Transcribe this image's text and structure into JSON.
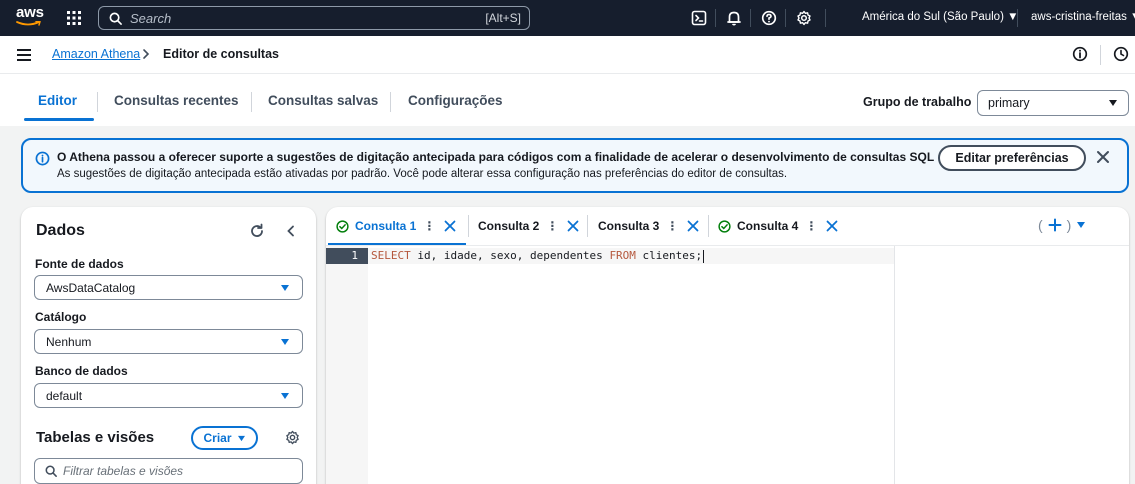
{
  "topnav": {
    "logo_text": "aws",
    "search_placeholder": "Search",
    "search_shortcut": "[Alt+S]",
    "region": "América do Sul (São Paulo) ▼",
    "account": "aws-cristina-freitas ▼"
  },
  "breadcrumb": {
    "service": "Amazon Athena",
    "current": "Editor de consultas"
  },
  "tabs": {
    "items": [
      "Editor",
      "Consultas recentes",
      "Consultas salvas",
      "Configurações"
    ],
    "active": "Editor",
    "workgroup_label": "Grupo de trabalho",
    "workgroup_value": "primary"
  },
  "banner": {
    "title": "O Athena passou a oferecer suporte a sugestões de digitação antecipada para códigos com a finalidade de acelerar o desenvolvimento de consultas SQL",
    "body": "As sugestões de digitação antecipada estão ativadas por padrão. Você pode alterar essa configuração nas preferências do editor de consultas.",
    "button": "Editar preferências"
  },
  "left_panel": {
    "title": "Dados",
    "data_source_label": "Fonte de dados",
    "data_source_value": "AwsDataCatalog",
    "catalog_label": "Catálogo",
    "catalog_value": "Nenhum",
    "database_label": "Banco de dados",
    "database_value": "default",
    "tables_title": "Tabelas e visões",
    "create_button": "Criar",
    "filter_placeholder": "Filtrar tabelas e visões"
  },
  "editor": {
    "query_tabs": [
      {
        "label": "Consulta 1",
        "status": "success"
      },
      {
        "label": "Consulta 2",
        "status": ""
      },
      {
        "label": "Consulta 3",
        "status": ""
      },
      {
        "label": "Consulta 4",
        "status": "success"
      }
    ],
    "line_number": "1",
    "code": {
      "kw_select": "SELECT",
      "columns": " id, idade, sexo, dependentes ",
      "kw_from": "FROM",
      "table": " clientes;"
    }
  },
  "colors": {
    "nav_bg": "#161e2d",
    "accent": "#0972d3",
    "success": "#037f0c",
    "banner_bg": "#f2f8fd",
    "keyword": "#b5573c"
  }
}
